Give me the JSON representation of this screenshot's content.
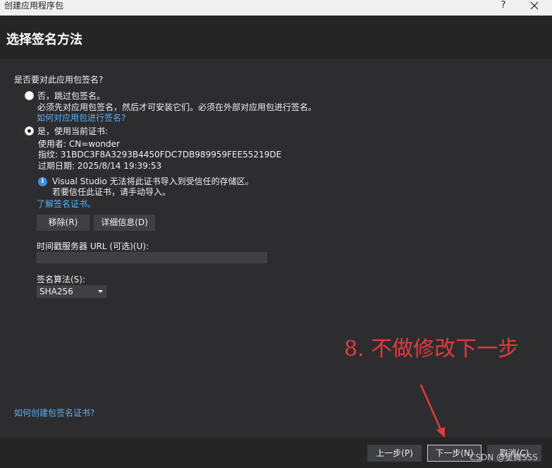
{
  "window": {
    "title": "创建应用程序包",
    "help": "?"
  },
  "header": {
    "title": "选择签名方法"
  },
  "prompt": "是否要对此应用包签名?",
  "option_skip": {
    "label": "否，跳过包签名。",
    "description": "必须先对应用包签名，然后才可安装它们。必须在外部对应用包进行签名。",
    "link": "如何对应用包进行签名?",
    "checked": false
  },
  "option_current": {
    "label": "是，使用当前证书:",
    "checked": true,
    "user": "使用者: CN=wonder",
    "thumbprint": "指纹: 31BDC3F8A3293B4450FDC7DB989959FEE55219DE",
    "expiry": "过期日期: 2025/8/14 19:39:53",
    "info_line1": "Visual Studio 无法将此证书导入到受信任的存储区。",
    "info_line2": "若要信任此证书，请手动导入。",
    "learn_link": "了解签名证书。"
  },
  "buttons": {
    "remove": "移除(R)",
    "details": "详细信息(D)"
  },
  "timestamp": {
    "label": "时间戳服务器 URL (可选)(U):",
    "value": ""
  },
  "algorithm": {
    "label": "签名算法(S):",
    "selected": "SHA256"
  },
  "create_cert_link": "如何创建包签名证书?",
  "annotation": "8. 不做修改下一步",
  "footer": {
    "prev": "上一步(P)",
    "next": "下一步(N)",
    "cancel": "取消(C)"
  },
  "watermark": "CSDN @星舞SSS",
  "colors": {
    "annotation": "#e03b3b",
    "link": "#5eaef0",
    "background": "#2d2d30"
  },
  "icons": {
    "info": "info-icon",
    "close": "close-icon",
    "dropdown": "chevron-down-icon",
    "arrow": "arrow-icon"
  }
}
